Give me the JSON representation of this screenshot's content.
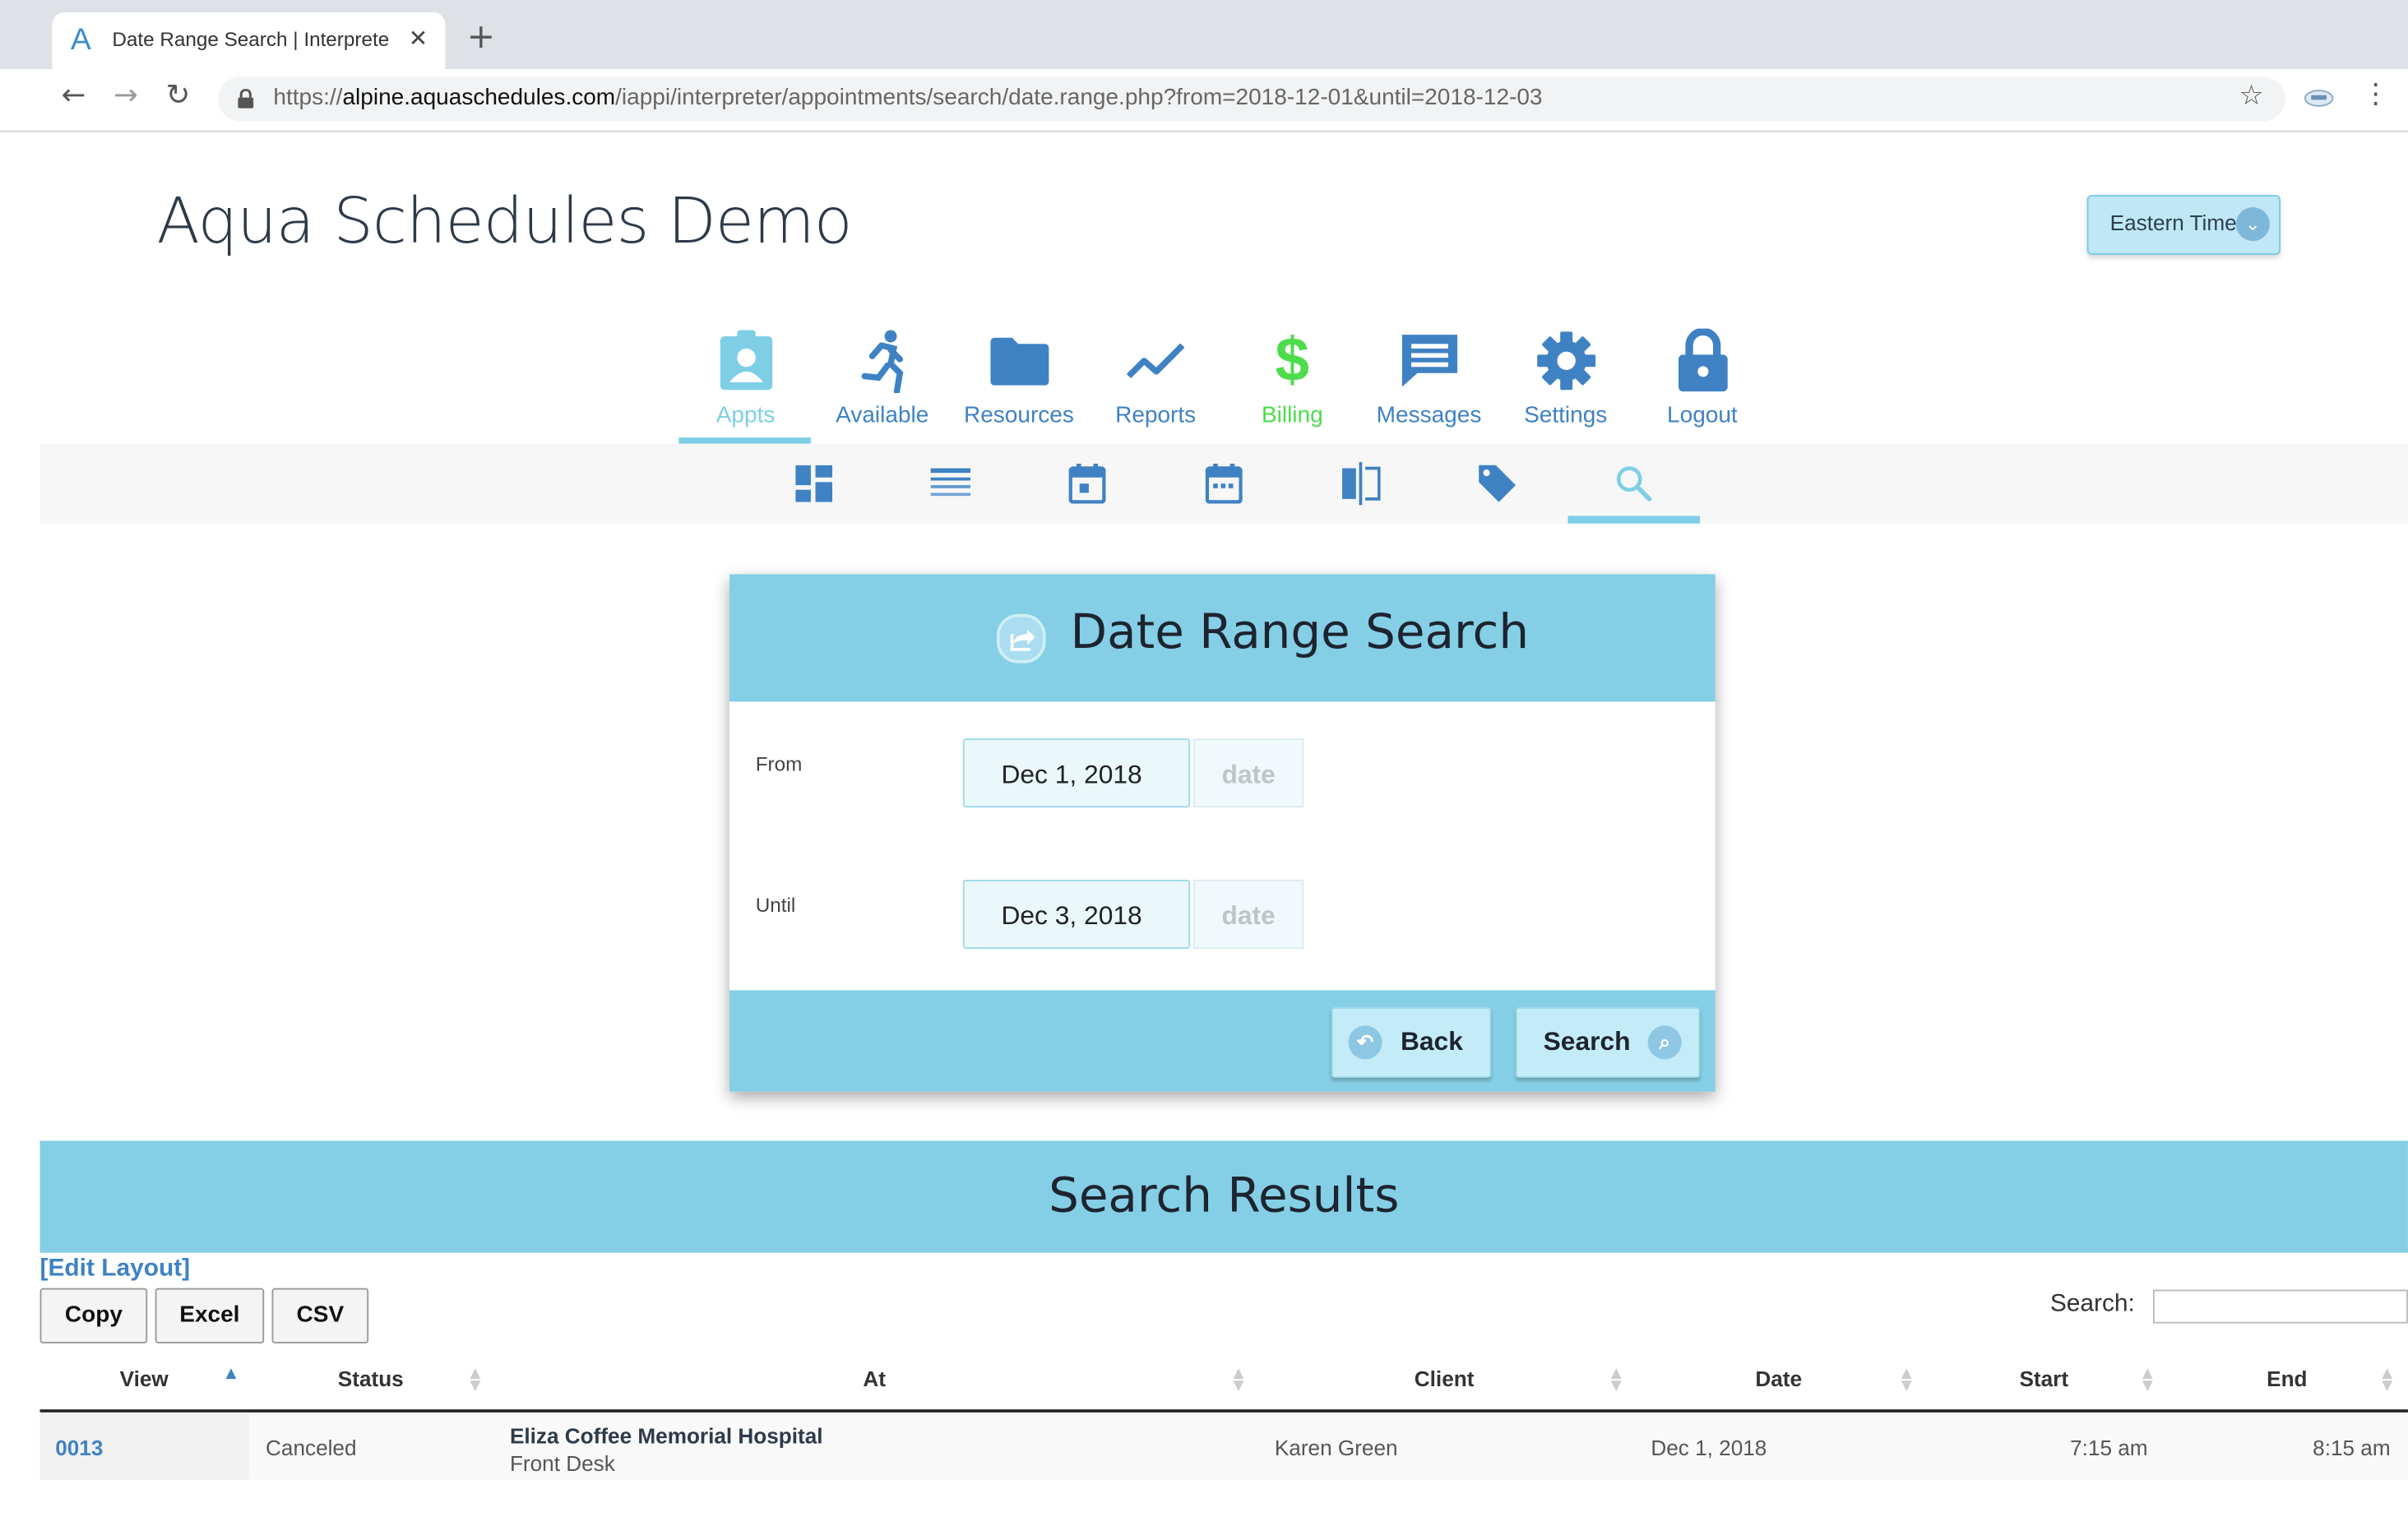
{
  "browser": {
    "tab_title": "Date Range Search | Interprete",
    "tab_logo": "A",
    "url_prefix": "https://",
    "url_host": "alpine.aquaschedules.com",
    "url_path": "/iappi/interpreter/appointments/search/date.range.php?from=2018-12-01&until=2018-12-03"
  },
  "header": {
    "title": "Aqua Schedules Demo",
    "timezone": "Eastern Time"
  },
  "main_nav": [
    {
      "label": "Appts",
      "icon": "appts-badge-icon",
      "active": true
    },
    {
      "label": "Available",
      "icon": "running-person-icon",
      "active": false
    },
    {
      "label": "Resources",
      "icon": "folder-icon",
      "active": false
    },
    {
      "label": "Reports",
      "icon": "line-chart-icon",
      "active": false
    },
    {
      "label": "Billing",
      "icon": "dollar-icon",
      "active": false
    },
    {
      "label": "Messages",
      "icon": "message-icon",
      "active": false
    },
    {
      "label": "Settings",
      "icon": "gear-icon",
      "active": false
    },
    {
      "label": "Logout",
      "icon": "lock-icon",
      "active": false
    }
  ],
  "sub_nav": [
    {
      "icon": "dashboard-icon"
    },
    {
      "icon": "list-table-icon"
    },
    {
      "icon": "calendar-day-icon"
    },
    {
      "icon": "calendar-week-icon"
    },
    {
      "icon": "split-view-icon"
    },
    {
      "icon": "tag-icon"
    },
    {
      "icon": "search-icon",
      "active": true
    }
  ],
  "search_panel": {
    "title": "Date Range Search",
    "from_label": "From",
    "from_value": "Dec 1, 2018",
    "until_label": "Until",
    "until_value": "Dec 3, 2018",
    "date_addon": "date",
    "back_label": "Back",
    "search_label": "Search"
  },
  "results": {
    "title": "Search Results",
    "edit_layout": "[Edit Layout]",
    "buttons": [
      "Copy",
      "Excel",
      "CSV"
    ],
    "search_label": "Search:",
    "columns": [
      "View",
      "Status",
      "At",
      "Client",
      "Date",
      "Start",
      "End"
    ],
    "rows": [
      {
        "view": "0013",
        "status": "Canceled",
        "at_name": "Eliza Coffee Memorial Hospital",
        "at_sub": "Front Desk",
        "client": "Karen Green",
        "date": "Dec 1, 2018",
        "start": "7:15 am",
        "end": "8:15 am"
      }
    ]
  },
  "colors": {
    "accent": "#84cfe5",
    "nav_blue": "#3f82c4",
    "billing_green": "#4cdc4c"
  }
}
